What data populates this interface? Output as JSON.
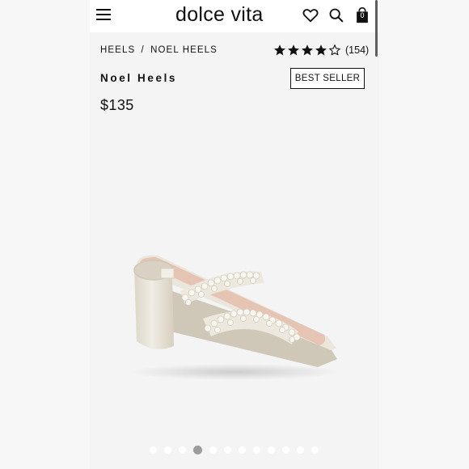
{
  "header": {
    "brand": "dolce vita",
    "cart_count": "0",
    "icons": [
      "menu-icon",
      "heart-icon",
      "search-icon",
      "bag-icon"
    ]
  },
  "breadcrumb": {
    "category": "HEELS",
    "separator": "/",
    "current": "NOEL HEELS"
  },
  "rating": {
    "stars": 4,
    "max_stars": 5,
    "count": "(154)"
  },
  "product": {
    "name": "Noel Heels",
    "badge": "BEST SELLER",
    "price": "$135"
  },
  "gallery": {
    "total_images": 12,
    "active_index": 3
  },
  "colors": {
    "background": "#f4f4f4",
    "text": "#111111",
    "shoe_cream": "#ebe6db",
    "shoe_insole": "#e6c4b4",
    "active_dot": "#9c9c9c"
  }
}
